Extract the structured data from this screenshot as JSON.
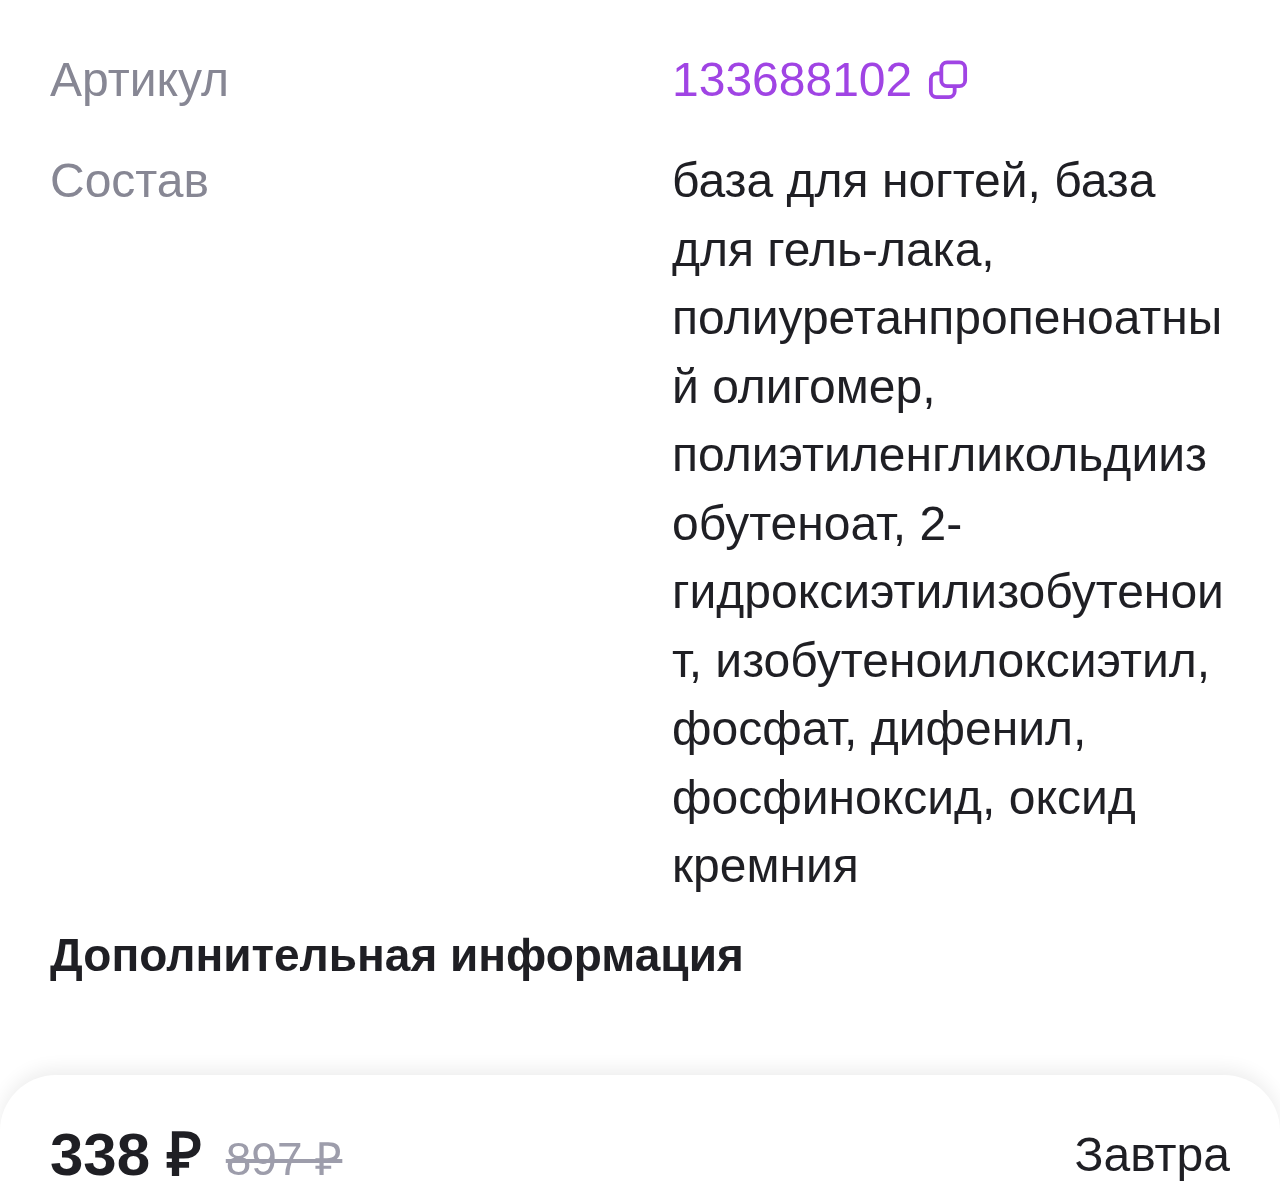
{
  "specs": [
    {
      "kind": "copyable",
      "label": "Артикул",
      "value": "133688102"
    },
    {
      "kind": "text",
      "label": "Состав",
      "value": "база для ногтей, база для гель-лака, полиуретанпропеноатный олигомер, полиэтиленгликольдиизобутеноат, 2-гидроксиэтилизобутеноит, изобутеноилоксиэтил, фосфат, дифенил, фосфиноксид, оксид кремния"
    }
  ],
  "section_title": "Дополнительная информация",
  "purchase_bar": {
    "price": "338 ₽",
    "old_price": "897 ₽",
    "delivery": "Завтра"
  }
}
